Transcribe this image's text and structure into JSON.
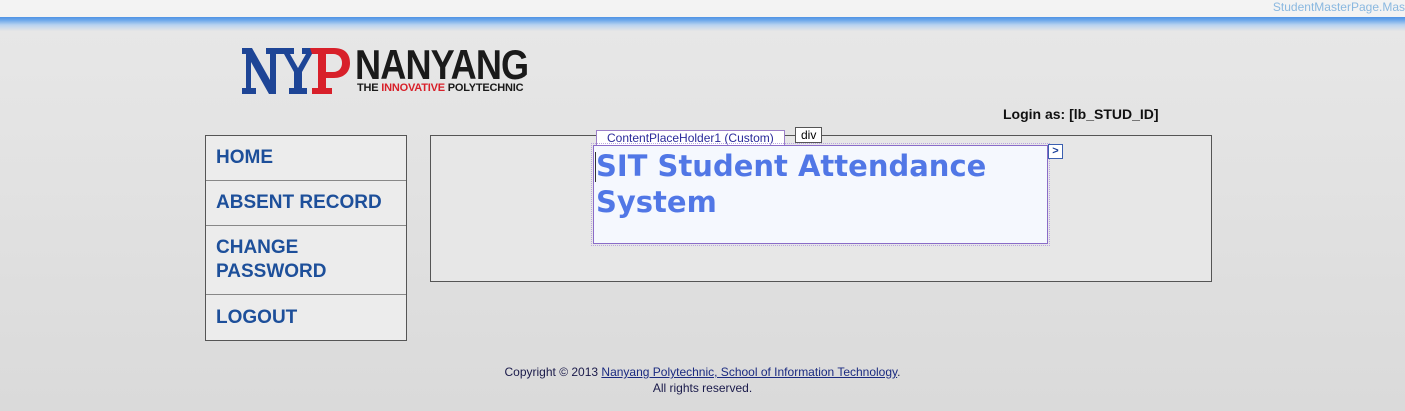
{
  "designer": {
    "master_page_name": "StudentMasterPage.Mas"
  },
  "logo": {
    "name": "NANYANG",
    "tag_prefix": "THE ",
    "tag_highlight": "INNOVATIVE",
    "tag_suffix": " POLYTECHNIC",
    "monogram": "NYP",
    "colors": {
      "blue": "#1e4596",
      "red": "#d8202a"
    }
  },
  "header": {
    "login_label": "Login as:",
    "login_value": "[lb_STUD_ID]"
  },
  "menu": {
    "items": [
      {
        "label": "HOME"
      },
      {
        "label": "ABSENT RECORD"
      },
      {
        "label": "CHANGE PASSWORD"
      },
      {
        "label": "LOGOUT"
      }
    ]
  },
  "content": {
    "placeholder_tab": "ContentPlaceHolder1 (Custom)",
    "div_tag": "div",
    "title": "SIT Student Attendance System",
    "arrow_glyph": ">"
  },
  "footer": {
    "copyright_prefix": "Copyright © 2013 ",
    "link_text": "Nanyang Polytechnic, School of Information Technology",
    "period": ".",
    "rights": "All rights reserved."
  }
}
